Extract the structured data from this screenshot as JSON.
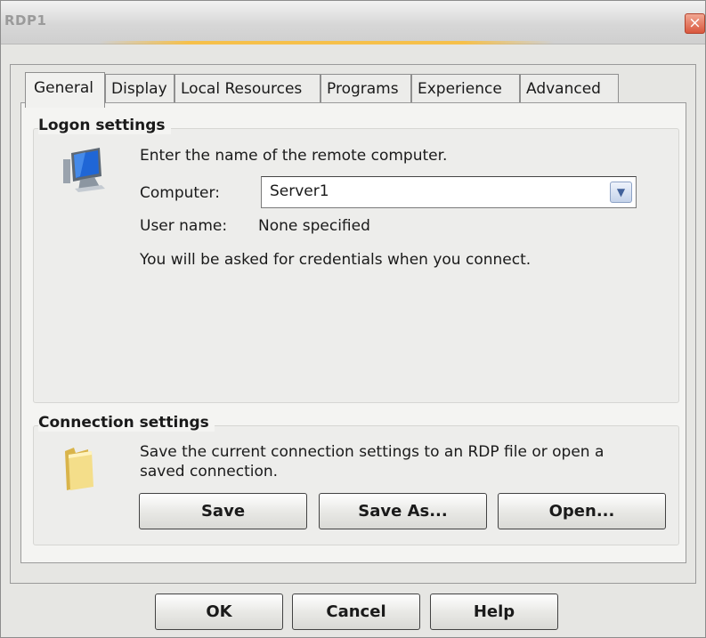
{
  "window": {
    "title": "RDP1",
    "close_glyph": "×"
  },
  "tabs": [
    {
      "label": "General",
      "active": true
    },
    {
      "label": "Display",
      "active": false
    },
    {
      "label": "Local Resources",
      "active": false
    },
    {
      "label": "Programs",
      "active": false
    },
    {
      "label": "Experience",
      "active": false
    },
    {
      "label": "Advanced",
      "active": false
    }
  ],
  "logon": {
    "title": "Logon settings",
    "icon": "computer-monitor-icon",
    "instruction": "Enter the name of the remote computer.",
    "computer_label": "Computer:",
    "computer_value": "Server1",
    "username_label": "User name:",
    "username_value": "None specified",
    "credentials_note": "You will be asked for credentials when you connect."
  },
  "connection": {
    "title": "Connection settings",
    "icon": "folder-icon",
    "description_line1": "Save the current connection settings to an RDP file or open a",
    "description_line2": "saved connection.",
    "save_label": "Save",
    "save_as_label": "Save As...",
    "open_label": "Open..."
  },
  "footer": {
    "ok_label": "OK",
    "cancel_label": "Cancel",
    "help_label": "Help"
  },
  "colors": {
    "accent": "#f6c04a",
    "close": "#d9573e",
    "combo_arrow": "#41619a"
  }
}
